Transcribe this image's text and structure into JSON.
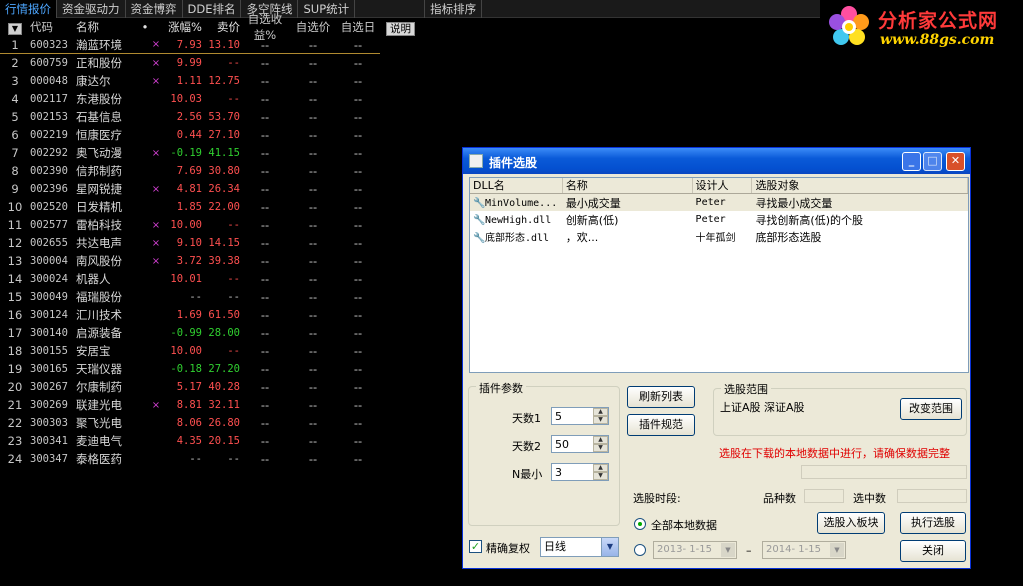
{
  "tabs": [
    "行情报价",
    "资金驱动力",
    "资金博弈",
    "DDE排名",
    "多空阵线",
    "SUP统计",
    "",
    "指标排序"
  ],
  "logo": {
    "title": "分析家公式网",
    "url_text": "www.88gs.com"
  },
  "table": {
    "headers": {
      "sort": "▼",
      "code": "代码",
      "name": "名称",
      "dot": "•",
      "chg": "涨幅%",
      "sell": "卖价",
      "y1": "自选收益%",
      "y2": "自选价",
      "y3": "自选日"
    },
    "explain_button": "说明",
    "rows": [
      {
        "idx": "1",
        "code": "600323",
        "name": "瀚蓝环境",
        "mark": "×",
        "chg": "7.93",
        "sell": "13.10",
        "dir": "up",
        "y1": "--",
        "y2": "--",
        "y3": "--"
      },
      {
        "idx": "2",
        "code": "600759",
        "name": "正和股份",
        "mark": "×",
        "chg": "9.99",
        "sell": "--",
        "dir": "up",
        "y1": "--",
        "y2": "--",
        "y3": "--"
      },
      {
        "idx": "3",
        "code": "000048",
        "name": "康达尔",
        "mark": "×",
        "chg": "1.11",
        "sell": "12.75",
        "dir": "up",
        "y1": "--",
        "y2": "--",
        "y3": "--"
      },
      {
        "idx": "4",
        "code": "002117",
        "name": "东港股份",
        "mark": "",
        "chg": "10.03",
        "sell": "--",
        "dir": "up",
        "y1": "--",
        "y2": "--",
        "y3": "--"
      },
      {
        "idx": "5",
        "code": "002153",
        "name": "石基信息",
        "mark": "",
        "chg": "2.56",
        "sell": "53.70",
        "dir": "up",
        "y1": "--",
        "y2": "--",
        "y3": "--"
      },
      {
        "idx": "6",
        "code": "002219",
        "name": "恒康医疗",
        "mark": "",
        "chg": "0.44",
        "sell": "27.10",
        "dir": "up",
        "y1": "--",
        "y2": "--",
        "y3": "--"
      },
      {
        "idx": "7",
        "code": "002292",
        "name": "奥飞动漫",
        "mark": "×",
        "chg": "-0.19",
        "sell": "41.15",
        "dir": "down",
        "y1": "--",
        "y2": "--",
        "y3": "--"
      },
      {
        "idx": "8",
        "code": "002390",
        "name": "信邦制药",
        "mark": "",
        "chg": "7.69",
        "sell": "30.80",
        "dir": "up",
        "y1": "--",
        "y2": "--",
        "y3": "--"
      },
      {
        "idx": "9",
        "code": "002396",
        "name": "星网锐捷",
        "mark": "×",
        "chg": "4.81",
        "sell": "26.34",
        "dir": "up",
        "y1": "--",
        "y2": "--",
        "y3": "--"
      },
      {
        "idx": "10",
        "code": "002520",
        "name": "日发精机",
        "mark": "",
        "chg": "1.85",
        "sell": "22.00",
        "dir": "up",
        "y1": "--",
        "y2": "--",
        "y3": "--"
      },
      {
        "idx": "11",
        "code": "002577",
        "name": "雷柏科技",
        "mark": "×",
        "chg": "10.00",
        "sell": "--",
        "dir": "up",
        "y1": "--",
        "y2": "--",
        "y3": "--"
      },
      {
        "idx": "12",
        "code": "002655",
        "name": "共达电声",
        "mark": "×",
        "chg": "9.10",
        "sell": "14.15",
        "dir": "up",
        "y1": "--",
        "y2": "--",
        "y3": "--"
      },
      {
        "idx": "13",
        "code": "300004",
        "name": "南风股份",
        "mark": "×",
        "chg": "3.72",
        "sell": "39.38",
        "dir": "up",
        "y1": "--",
        "y2": "--",
        "y3": "--"
      },
      {
        "idx": "14",
        "code": "300024",
        "name": "机器人",
        "mark": "",
        "chg": "10.01",
        "sell": "--",
        "dir": "up",
        "y1": "--",
        "y2": "--",
        "y3": "--"
      },
      {
        "idx": "15",
        "code": "300049",
        "name": "福瑞股份",
        "mark": "",
        "chg": "--",
        "sell": "--",
        "dir": "flat",
        "y1": "--",
        "y2": "--",
        "y3": "--"
      },
      {
        "idx": "16",
        "code": "300124",
        "name": "汇川技术",
        "mark": "",
        "chg": "1.69",
        "sell": "61.50",
        "dir": "up",
        "y1": "--",
        "y2": "--",
        "y3": "--"
      },
      {
        "idx": "17",
        "code": "300140",
        "name": "启源装备",
        "mark": "",
        "chg": "-0.99",
        "sell": "28.00",
        "dir": "down",
        "y1": "--",
        "y2": "--",
        "y3": "--"
      },
      {
        "idx": "18",
        "code": "300155",
        "name": "安居宝",
        "mark": "",
        "chg": "10.00",
        "sell": "--",
        "dir": "up",
        "y1": "--",
        "y2": "--",
        "y3": "--"
      },
      {
        "idx": "19",
        "code": "300165",
        "name": "天瑞仪器",
        "mark": "",
        "chg": "-0.18",
        "sell": "27.20",
        "dir": "down",
        "y1": "--",
        "y2": "--",
        "y3": "--"
      },
      {
        "idx": "20",
        "code": "300267",
        "name": "尔康制药",
        "mark": "",
        "chg": "5.17",
        "sell": "40.28",
        "dir": "up",
        "y1": "--",
        "y2": "--",
        "y3": "--"
      },
      {
        "idx": "21",
        "code": "300269",
        "name": "联建光电",
        "mark": "×",
        "chg": "8.81",
        "sell": "32.11",
        "dir": "up",
        "y1": "--",
        "y2": "--",
        "y3": "--"
      },
      {
        "idx": "22",
        "code": "300303",
        "name": "聚飞光电",
        "mark": "",
        "chg": "8.06",
        "sell": "26.80",
        "dir": "up",
        "y1": "--",
        "y2": "--",
        "y3": "--"
      },
      {
        "idx": "23",
        "code": "300341",
        "name": "麦迪电气",
        "mark": "",
        "chg": "4.35",
        "sell": "20.15",
        "dir": "up",
        "y1": "--",
        "y2": "--",
        "y3": "--"
      },
      {
        "idx": "24",
        "code": "300347",
        "name": "泰格医药",
        "mark": "",
        "chg": "--",
        "sell": "--",
        "dir": "flat",
        "y1": "--",
        "y2": "--",
        "y3": "--"
      }
    ]
  },
  "dialog": {
    "title": "插件选股",
    "list_headers": [
      "DLL名",
      "名称",
      "设计人",
      "选股对象"
    ],
    "plugins": [
      {
        "dll": "MinVolume...",
        "name": "最小成交量",
        "author": "Peter",
        "target": "寻找最小成交量"
      },
      {
        "dll": "NewHigh.dll",
        "name": "创新高(低)",
        "author": "Peter",
        "target": "寻找创新高(低)的个股"
      },
      {
        "dll": "底部形态.dll",
        "name": "，欢...",
        "author": "十年孤剑",
        "target": "底部形态选股"
      }
    ],
    "params_title": "插件参数",
    "params": [
      {
        "label": "天数1",
        "value": "5"
      },
      {
        "label": "天数2",
        "value": "50"
      },
      {
        "label": "N最小",
        "value": "3"
      }
    ],
    "refresh_button": "刷新列表",
    "spec_button": "插件规范",
    "range_title": "选股范围",
    "range_text": "上证A股 深证A股",
    "change_range_button": "改变范围",
    "warning": "选股在下载的本地数据中进行，请确保数据完整",
    "period_label": "选股时段:",
    "count_label": "品种数",
    "selected_label": "选中数",
    "all_local_label": "全部本地数据",
    "date_from": "2013- 1-15",
    "date_to": "2014- 1-15",
    "date_sep": "–",
    "to_block_button": "选股入板块",
    "execute_button": "执行选股",
    "close_button": "关闭",
    "exact_rights_label": "精确复权",
    "period_select": "日线"
  }
}
